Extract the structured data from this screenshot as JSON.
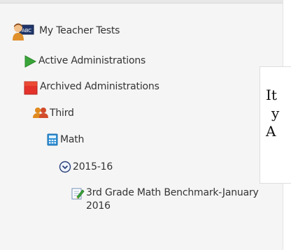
{
  "tree": {
    "root": {
      "label": "My Teacher Tests",
      "icon": "teacher-avatar-icon"
    },
    "active": {
      "label": "Active Administrations",
      "icon": "play-triangle-icon",
      "color": "#3aa53a"
    },
    "archived": {
      "label": "Archived Administrations",
      "icon": "archive-square-icon",
      "color": "#e4322b"
    },
    "grade": {
      "label": "Third",
      "icon": "people-icon"
    },
    "subject": {
      "label": "Math",
      "icon": "calculator-icon"
    },
    "year": {
      "label": "2015-16",
      "icon": "circle-chevron-down-icon"
    },
    "test": {
      "label": "3rd Grade Math Benchmark-January\n2016",
      "icon": "edit-document-icon"
    }
  },
  "overlay": {
    "line1": "It",
    "line2": "y",
    "line3": "A"
  }
}
